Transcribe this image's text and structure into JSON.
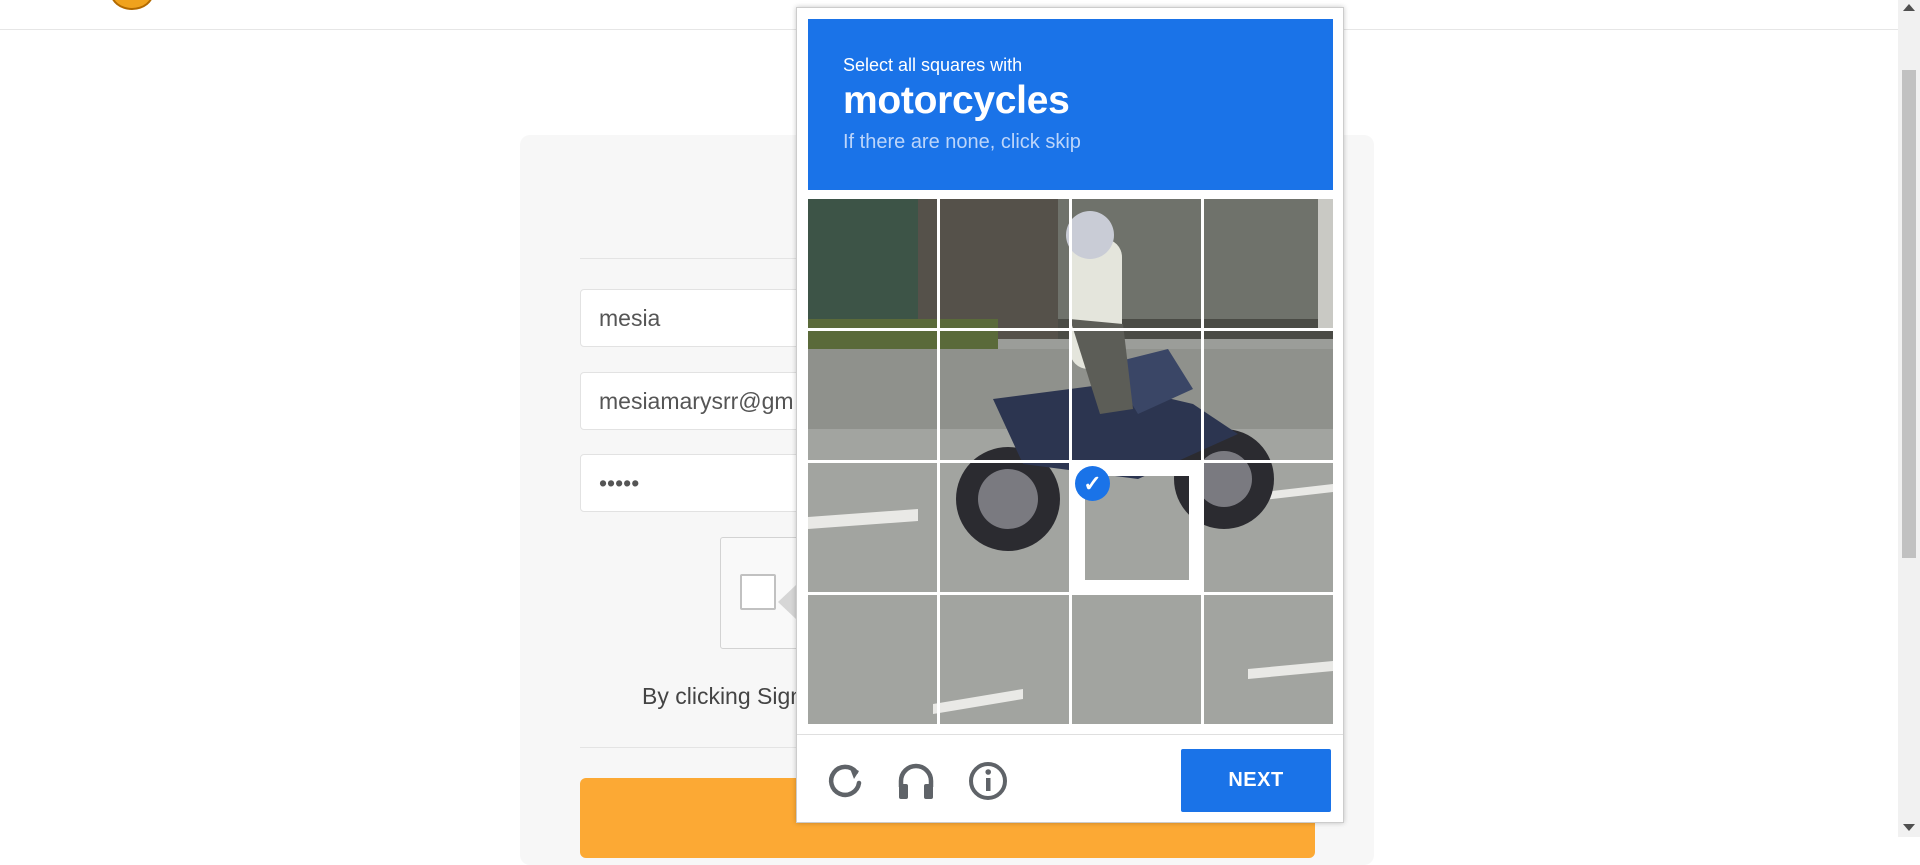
{
  "form": {
    "name_value": "mesia",
    "email_value": "mesiamarysrr@gm",
    "password_value": "•••••",
    "terms_text": "By clicking Sign"
  },
  "challenge": {
    "prompt": "Select all squares with",
    "object": "motorcycles",
    "hint": "If there are none, click skip",
    "grid": {
      "rows": 4,
      "cols": 4,
      "selected_tiles": [
        10
      ]
    },
    "footer": {
      "reload_icon": "reload-icon",
      "audio_icon": "headphones-icon",
      "info_icon": "info-icon",
      "next_label": "NEXT"
    },
    "colors": {
      "accent": "#1a73e8",
      "signup_button": "#fca934"
    }
  }
}
